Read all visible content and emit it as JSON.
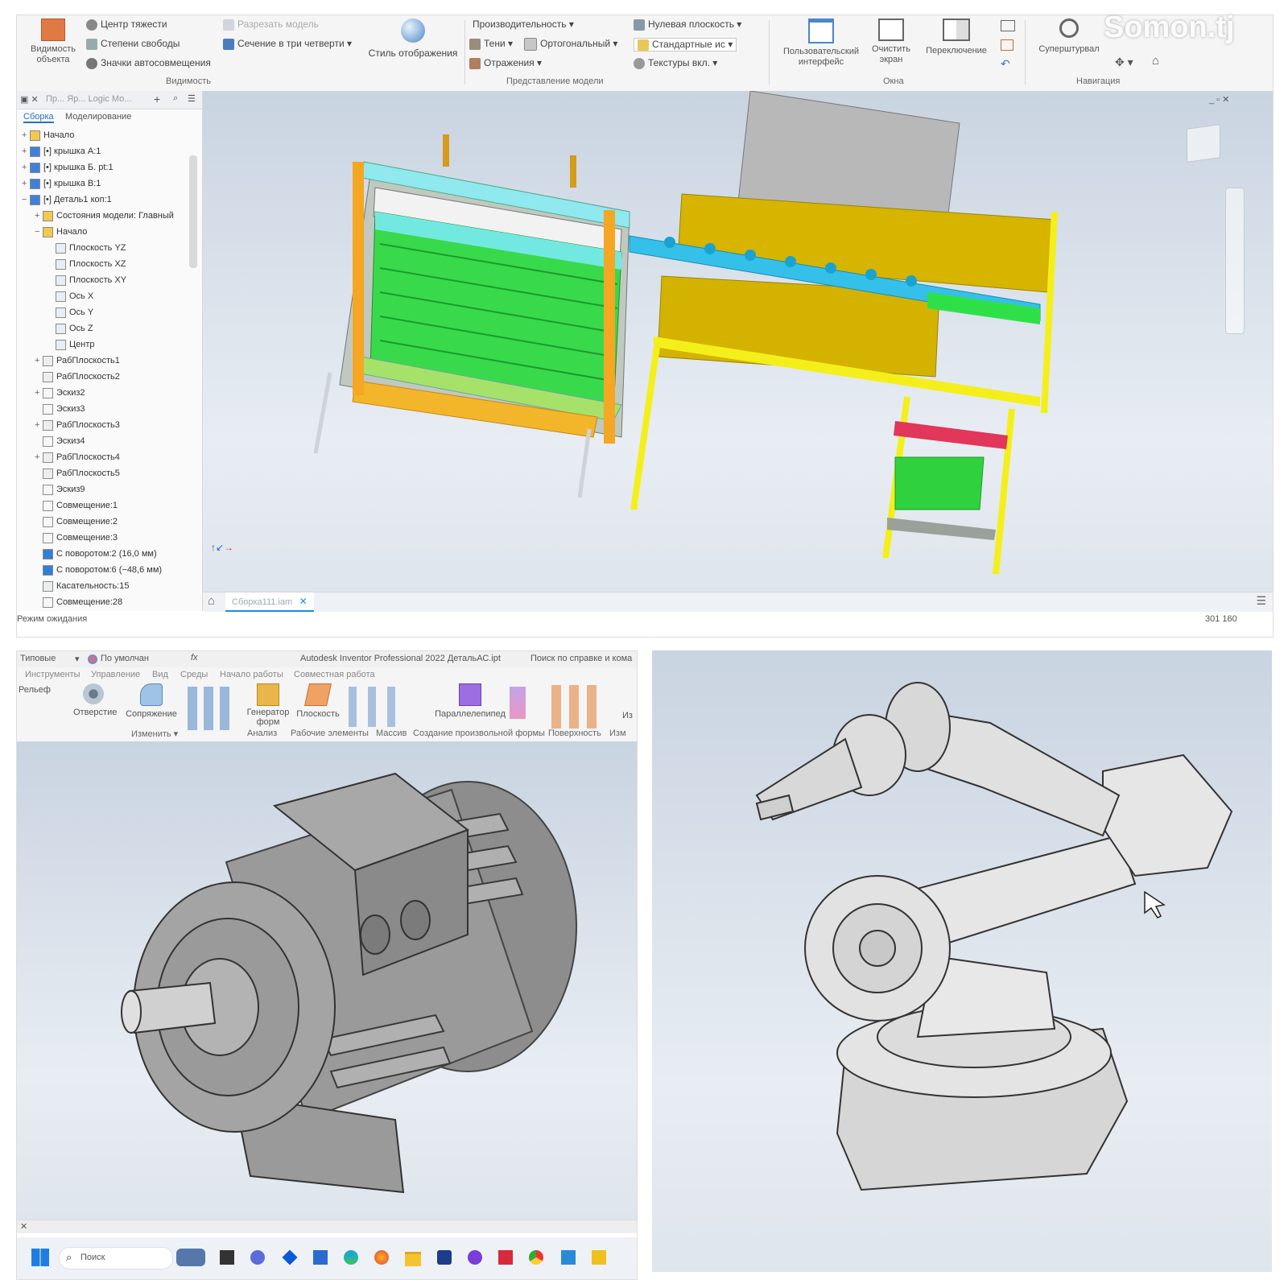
{
  "watermark": "Somon.tj",
  "top_app": {
    "ribbon": {
      "visibility_group": {
        "object_visibility": "Видимость объекта",
        "items": [
          "Центр тяжести",
          "Степени свободы",
          "Значки автосовмещения"
        ],
        "label": "Видимость"
      },
      "section_items": [
        "Разрезать модель",
        "Сечение в три четверти"
      ],
      "display_style": "Стиль отображения",
      "model_view_group": {
        "performance": "Производительность",
        "shadows": "Тени",
        "orthographic": "Ортогональный",
        "reflections": "Отражения",
        "ground_plane": "Нулевая плоскость",
        "standard": "Стандартные ис",
        "textures": "Текстуры вкл.",
        "label": "Представление модели"
      },
      "windows_group": {
        "user_interface": "Пользовательский интерфейс",
        "clean_screen": "Очистить экран",
        "switch": "Переключение",
        "label": "Окна"
      },
      "nav_group": {
        "steering": "Суперштурвал",
        "label": "Навигация"
      }
    },
    "browser": {
      "tabs": [
        "Сборка",
        "Моделирование"
      ],
      "search_hint": "Пр...  Яр...  Logic  Мо...",
      "items": [
        {
          "label": "Начало",
          "level": 0,
          "exp": "+",
          "kind": "folder"
        },
        {
          "label": "[•] крышка А:1",
          "level": 0,
          "exp": "+",
          "kind": "part"
        },
        {
          "label": "[•] крышка Б. рt:1",
          "level": 0,
          "exp": "+",
          "kind": "part"
        },
        {
          "label": "[•] крышка В:1",
          "level": 0,
          "exp": "+",
          "kind": "part"
        },
        {
          "label": "[•] Деталь1 коп:1",
          "level": 0,
          "exp": "−",
          "kind": "part"
        },
        {
          "label": "Состояния модели: Главный",
          "level": 1,
          "exp": "+",
          "kind": "folder"
        },
        {
          "label": "Начало",
          "level": 1,
          "exp": "−",
          "kind": "folder"
        },
        {
          "label": "Плоскость YZ",
          "level": 2,
          "exp": "",
          "kind": "plane"
        },
        {
          "label": "Плоскость XZ",
          "level": 2,
          "exp": "",
          "kind": "plane"
        },
        {
          "label": "Плоскость XY",
          "level": 2,
          "exp": "",
          "kind": "plane"
        },
        {
          "label": "Ось X",
          "level": 2,
          "exp": "",
          "kind": "axis"
        },
        {
          "label": "Ось Y",
          "level": 2,
          "exp": "",
          "kind": "axis"
        },
        {
          "label": "Ось Z",
          "level": 2,
          "exp": "",
          "kind": "axis"
        },
        {
          "label": "Центр",
          "level": 2,
          "exp": "",
          "kind": "point"
        },
        {
          "label": "РабПлоскость1",
          "level": 1,
          "exp": "+",
          "kind": "plane"
        },
        {
          "label": "РабПлоскость2",
          "level": 1,
          "exp": "",
          "kind": "plane"
        },
        {
          "label": "Эскиз2",
          "level": 1,
          "exp": "+",
          "kind": "sketch"
        },
        {
          "label": "Эскиз3",
          "level": 1,
          "exp": "",
          "kind": "sketch"
        },
        {
          "label": "РабПлоскость3",
          "level": 1,
          "exp": "+",
          "kind": "plane"
        },
        {
          "label": "Эскиз4",
          "level": 1,
          "exp": "",
          "kind": "sketch"
        },
        {
          "label": "РабПлоскость4",
          "level": 1,
          "exp": "+",
          "kind": "plane"
        },
        {
          "label": "РабПлоскость5",
          "level": 1,
          "exp": "",
          "kind": "plane"
        },
        {
          "label": "Эскиз9",
          "level": 1,
          "exp": "",
          "kind": "sketch"
        },
        {
          "label": "Совмещение:1",
          "level": 1,
          "exp": "",
          "kind": "sketch"
        },
        {
          "label": "Совмещение:2",
          "level": 1,
          "exp": "",
          "kind": "sketch"
        },
        {
          "label": "Совмещение:3",
          "level": 1,
          "exp": "",
          "kind": "sketch"
        },
        {
          "label": "С поворотом:2 (16,0 мм)",
          "level": 1,
          "exp": "",
          "kind": "flag"
        },
        {
          "label": "С поворотом:6 (−48,6 мм)",
          "level": 1,
          "exp": "",
          "kind": "flag"
        },
        {
          "label": "Касательность:15",
          "level": 1,
          "exp": "",
          "kind": "plane"
        },
        {
          "label": "Совмещение:28",
          "level": 1,
          "exp": "",
          "kind": "sketch"
        }
      ]
    },
    "doc_tab": "Сборка111.iam",
    "status_left": "Режим ожидания",
    "status_right": "301   160"
  },
  "bottom_left_app": {
    "qat": {
      "preset": "Типовые",
      "material": "По умолчан",
      "title": "Autodesk Inventor Professional 2022   ДетальАС.ipt",
      "search": "Поиск по справке и кома"
    },
    "tabs": [
      "Инструменты",
      "Управление",
      "Вид",
      "Среды",
      "Начало работы",
      "Совместная работа"
    ],
    "tools": {
      "relief": "Рельеф",
      "hole": "Отверстие",
      "fillet": "Сопряжение",
      "frame_gen": "Генератор форм",
      "plane": "Плоскость",
      "box": "Параллелепипед",
      "izo": "Из"
    },
    "groups": [
      "Изменить",
      "Анализ",
      "Рабочие элементы",
      "Массив",
      "Создание произвольной формы",
      "Поверхность",
      "Изм"
    ],
    "taskbar": {
      "search": "Поиск"
    }
  },
  "bottom_right_app": {}
}
